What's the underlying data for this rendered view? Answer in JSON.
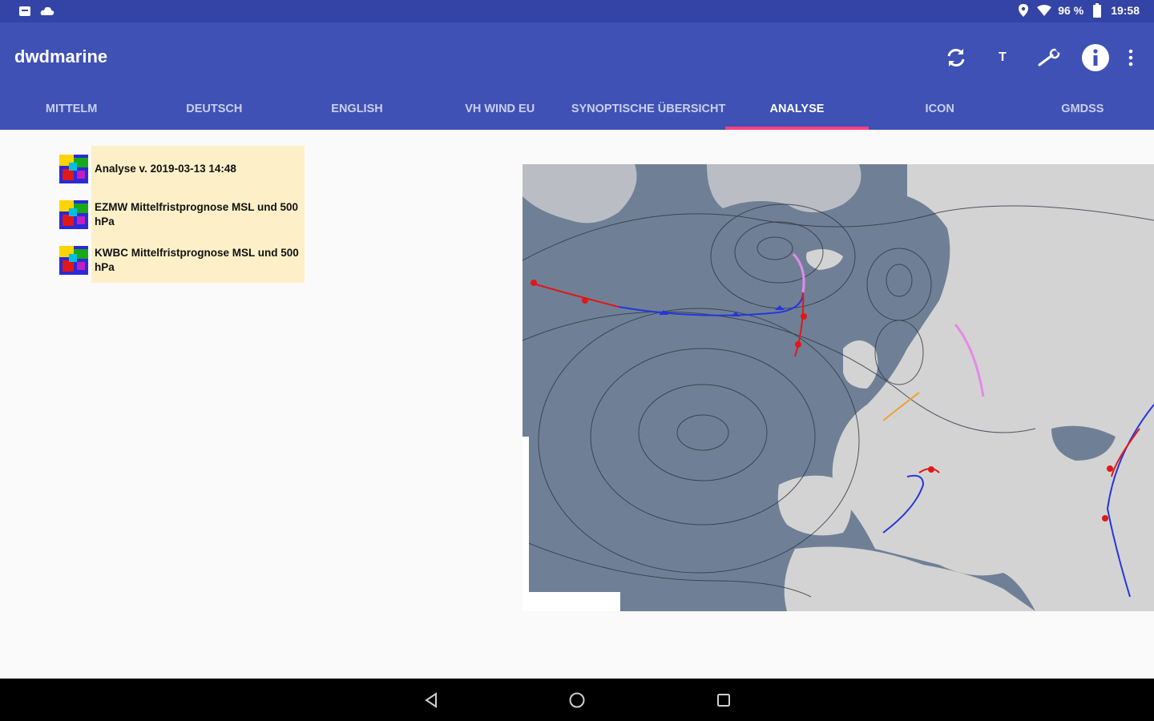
{
  "status_bar": {
    "battery": "96 %",
    "time": "19:58",
    "icons": [
      "notification-icon",
      "cloud-icon",
      "location-icon",
      "wifi-icon",
      "battery-icon"
    ]
  },
  "app": {
    "title": "dwdmarine",
    "actions": {
      "refresh_icon": "refresh-icon",
      "text_label": "T",
      "tools_icon": "wrench-icon",
      "info_icon": "info-icon",
      "overflow_icon": "more-vert-icon"
    },
    "accent": "#3f51b5",
    "status_color": "#3343a6",
    "indicator_color": "#ff4081"
  },
  "tabs": [
    {
      "label": "MITTELM",
      "active": false
    },
    {
      "label": "DEUTSCH",
      "active": false
    },
    {
      "label": "ENGLISH",
      "active": false
    },
    {
      "label": "VH WIND EU",
      "active": false
    },
    {
      "label": "SYNOPTISCHE ÜBERSICHT",
      "active": false
    },
    {
      "label": "ANALYSE",
      "active": true
    },
    {
      "label": "ICON",
      "active": false
    },
    {
      "label": "GMDSS",
      "active": false
    }
  ],
  "list": {
    "items": [
      {
        "label": "Analyse v. 2019-03-13 14:48"
      },
      {
        "label": "EZMW Mittelfristprognose MSL und 500 hPa"
      },
      {
        "label": "KWBC  Mittelfristprognose MSL und 500 hPa"
      }
    ],
    "item_bg": "#fdf0c8"
  },
  "map": {
    "name": "weather-analysis-map",
    "sea_color": "#6f8096",
    "land_color": "#d3d3d3"
  },
  "nav": {
    "back_icon": "back-icon",
    "home_icon": "home-icon",
    "recents_icon": "recents-icon"
  }
}
